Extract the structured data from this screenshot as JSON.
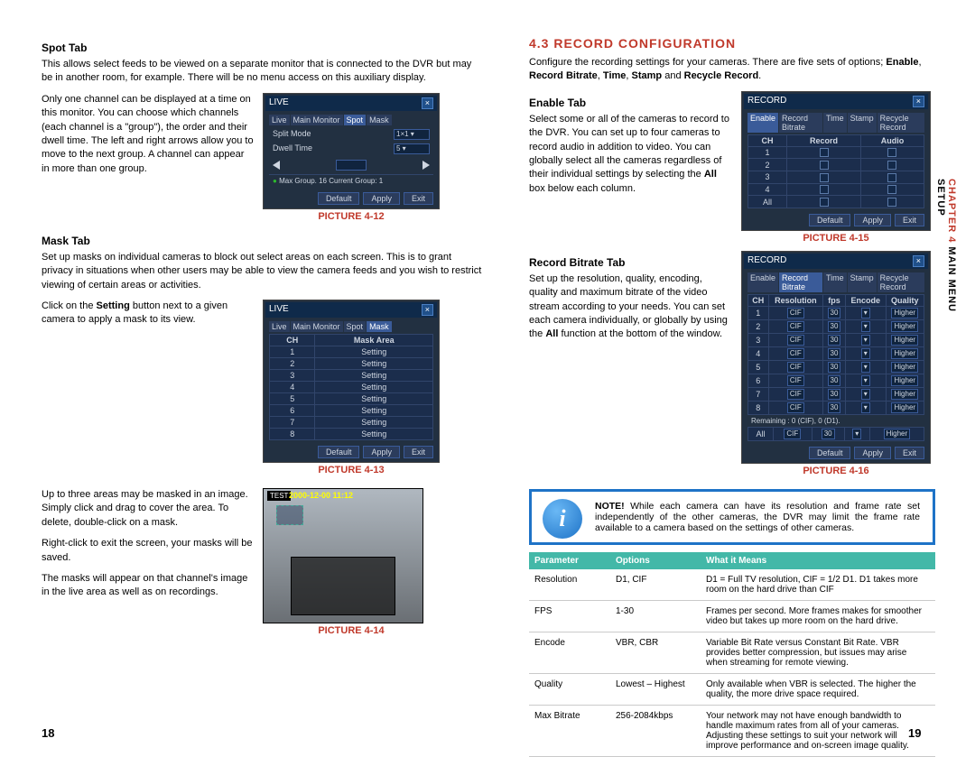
{
  "left": {
    "spot_tab": {
      "head": "Spot Tab",
      "desc": "This allows select feeds to be viewed on a separate monitor that is connected to the DVR but may be in another room, for example. There will be no menu access on this auxiliary display.",
      "para": "Only one channel can be displayed at a time on this monitor. You can choose which channels (each channel is a \"group\"), the order and their dwell time. The left and right arrows allow you to move to the next group. A channel can appear in more than one group."
    },
    "fig12": {
      "title": "LIVE",
      "tabs": [
        "Live",
        "Main Monitor",
        "Spot",
        "Mask"
      ],
      "row_split": "Split Mode",
      "row_dwell": "Dwell Time",
      "footer": "Max Group. 16   Current Group: 1",
      "btn_default": "Default",
      "btn_apply": "Apply",
      "btn_exit": "Exit",
      "caption": "PICTURE 4-12"
    },
    "mask_tab": {
      "head": "Mask Tab",
      "desc": "Set up masks on individual cameras to block out select areas on each screen. This is to grant privacy in situations when other users may be able to view the camera feeds and you wish to restrict viewing of certain areas or activities."
    },
    "fig13": {
      "title": "LIVE",
      "tabs": [
        "Live",
        "Main Monitor",
        "Spot",
        "Mask"
      ],
      "col_ch": "CH",
      "col_area": "Mask Area",
      "setting": "Setting",
      "caption": "PICTURE 4-13",
      "side": "Click on the <b>Setting</b> button next to a given camera to apply a mask to its view."
    },
    "fig14": {
      "p1": "Up to three areas may be masked in an image. Simply click and drag to cover the area. To delete, double-click on a mask.",
      "p2": "Right-click to exit the screen, your masks will be saved.",
      "p3": "The masks will appear on that channel's image in the live area as well as on recordings.",
      "stamp": "2000-12-00 11:12",
      "caption": "PICTURE 4-14"
    }
  },
  "right": {
    "section": "4.3 RECORD CONFIGURATION",
    "intro": "Configure the recording settings for your cameras. There are five sets of options; <b>Enable</b>, <b>Record Bitrate</b>, <b>Time</b>, <b>Stamp</b> and <b>Recycle Record</b>.",
    "enable": {
      "head": "Enable Tab",
      "desc": "Select some or all of the cameras to record to the DVR. You can set up to four cameras to record audio in addition to video. You can globally select all the cameras regardless of their individual settings by selecting the <b>All</b> box below each column."
    },
    "fig15": {
      "title": "RECORD",
      "tabs": [
        "Enable",
        "Record Bitrate",
        "Time",
        "Stamp",
        "Recycle Record"
      ],
      "c1": "CH",
      "c2": "Record",
      "c3": "Audio",
      "caption": "PICTURE 4-15"
    },
    "bitrate": {
      "head": "Record Bitrate Tab",
      "desc": "Set up the resolution, quality, encoding, quality and maximum bitrate of the video stream according to your needs. You can set each camera individually, or globally by using the <b>All</b> function at the bottom of the window."
    },
    "fig16": {
      "title": "RECORD",
      "tabs": [
        "Enable",
        "Record Bitrate",
        "Time",
        "Stamp",
        "Recycle Record"
      ],
      "hd": [
        "CH",
        "Resolution",
        "fps",
        "Encode",
        "Quality"
      ],
      "cell_res": "CIF",
      "cell_fps": "30",
      "cell_q": "Higher",
      "remaining": "Remaining : 0 (CIF), 0 (D1).",
      "caption": "PICTURE 4-16"
    },
    "note": {
      "bold": "NOTE!",
      "text": " While each camera can have its resolution and frame rate set independently of the other cameras, the DVR may limit the frame rate available to a camera based on the settings of other cameras."
    },
    "table": {
      "h": [
        "Parameter",
        "Options",
        "What it Means"
      ],
      "rows": [
        {
          "p": "Resolution",
          "o": "D1, CIF",
          "m": "D1 = Full TV resolution, CIF = 1/2 D1. D1 takes more room on the hard drive than CIF"
        },
        {
          "p": "FPS",
          "o": "1-30",
          "m": "Frames per second. More frames makes for smoother video but takes up more room on the hard drive."
        },
        {
          "p": "Encode",
          "o": "VBR, CBR",
          "m": "Variable Bit Rate versus Constant Bit Rate. VBR provides better compression, but issues may arise when streaming for remote viewing."
        },
        {
          "p": "Quality",
          "o": "Lowest – Highest",
          "m": "Only available when VBR is selected. The higher the quality, the more drive space required."
        },
        {
          "p": "Max Bitrate",
          "o": "256-2084kbps",
          "m": "Your network may not have enough bandwidth to handle maximum rates from all of your cameras. Adjusting these settings to suit your network will improve performance and on-screen image quality."
        }
      ]
    }
  },
  "pages": {
    "left": "18",
    "right": "19"
  },
  "thumb": {
    "ch": "CHAPTER 4",
    "rest": "  MAIN MENU SETUP"
  }
}
